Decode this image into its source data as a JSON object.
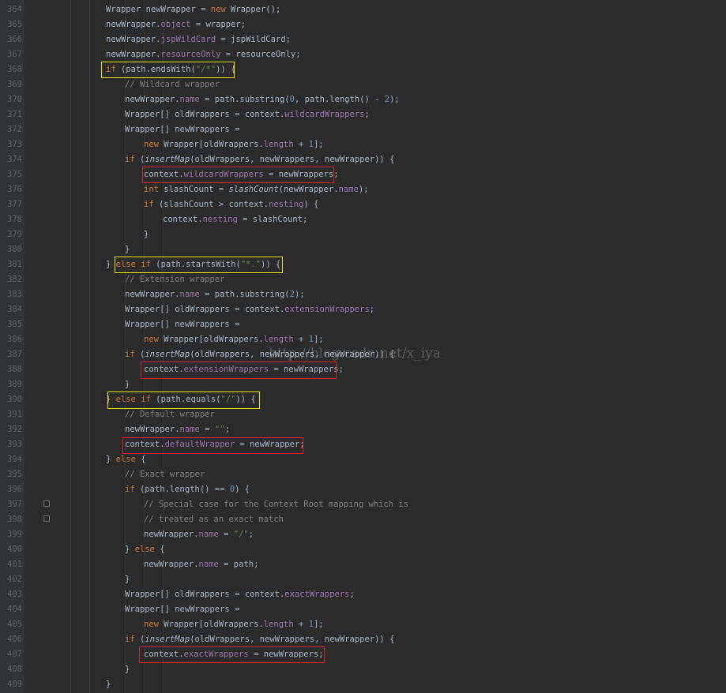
{
  "editor": {
    "watermark": "http://blog.csdn.net/x_iya",
    "lines": [
      {
        "n": "364",
        "i": 0,
        "t": [
          [
            "Wrapper newWrapper = ",
            ""
          ],
          [
            "new",
            "kw"
          ],
          [
            " Wrapper();",
            ""
          ]
        ]
      },
      {
        "n": "365",
        "i": 0,
        "t": [
          [
            "newWrapper.",
            ""
          ],
          [
            "object",
            "fd"
          ],
          [
            " = wrapper;",
            ""
          ]
        ]
      },
      {
        "n": "366",
        "i": 0,
        "t": [
          [
            "newWrapper.",
            ""
          ],
          [
            "jspWildCard",
            "fd"
          ],
          [
            " = jspWildCard;",
            ""
          ]
        ]
      },
      {
        "n": "367",
        "i": 0,
        "t": [
          [
            "newWrapper.",
            ""
          ],
          [
            "resourceOnly",
            "fd"
          ],
          [
            " = resourceOnly;",
            ""
          ]
        ]
      },
      {
        "n": "368",
        "i": 0,
        "t": [
          [
            "if",
            "kw"
          ],
          [
            " (path.endsWith(",
            ""
          ],
          [
            "\"/*\"",
            "str"
          ],
          [
            ")) {",
            ""
          ]
        ]
      },
      {
        "n": "369",
        "i": 1,
        "t": [
          [
            "// Wildcard wrapper",
            "cm"
          ]
        ]
      },
      {
        "n": "370",
        "i": 1,
        "t": [
          [
            "newWrapper.",
            ""
          ],
          [
            "name",
            "fd"
          ],
          [
            " = path.substring(",
            ""
          ],
          [
            "0",
            "num"
          ],
          [
            ", path.length() - ",
            ""
          ],
          [
            "2",
            "num"
          ],
          [
            ");",
            ""
          ]
        ]
      },
      {
        "n": "371",
        "i": 1,
        "t": [
          [
            "Wrapper[] oldWrappers = context.",
            ""
          ],
          [
            "wildcardWrappers",
            "fd"
          ],
          [
            ";",
            ""
          ]
        ]
      },
      {
        "n": "372",
        "i": 1,
        "t": [
          [
            "Wrapper[] newWrappers =",
            ""
          ]
        ]
      },
      {
        "n": "373",
        "i": 2,
        "t": [
          [
            "new",
            "kw"
          ],
          [
            " Wrapper[oldWrappers.",
            ""
          ],
          [
            "length",
            "fd"
          ],
          [
            " + ",
            ""
          ],
          [
            "1",
            "num"
          ],
          [
            "];",
            ""
          ]
        ]
      },
      {
        "n": "374",
        "i": 1,
        "t": [
          [
            "if",
            "kw"
          ],
          [
            " (",
            ""
          ],
          [
            "insertMap",
            "it"
          ],
          [
            "(oldWrappers, newWrappers, newWrapper)) {",
            ""
          ]
        ]
      },
      {
        "n": "375",
        "i": 2,
        "t": [
          [
            "context.",
            ""
          ],
          [
            "wildcardWrappers",
            "fd"
          ],
          [
            " = newWrappers;",
            ""
          ]
        ]
      },
      {
        "n": "376",
        "i": 2,
        "t": [
          [
            "int",
            "kw"
          ],
          [
            " slashCount = ",
            ""
          ],
          [
            "slashCount",
            "it"
          ],
          [
            "(newWrapper.",
            ""
          ],
          [
            "name",
            "fd"
          ],
          [
            ");",
            ""
          ]
        ]
      },
      {
        "n": "377",
        "i": 2,
        "t": [
          [
            "if",
            "kw"
          ],
          [
            " (slashCount > context.",
            ""
          ],
          [
            "nesting",
            "fd"
          ],
          [
            ") {",
            ""
          ]
        ]
      },
      {
        "n": "378",
        "i": 3,
        "t": [
          [
            "context.",
            ""
          ],
          [
            "nesting",
            "fd"
          ],
          [
            " = slashCount;",
            ""
          ]
        ]
      },
      {
        "n": "379",
        "i": 2,
        "t": [
          [
            "}",
            ""
          ]
        ]
      },
      {
        "n": "380",
        "i": 1,
        "t": [
          [
            "}",
            ""
          ]
        ]
      },
      {
        "n": "381",
        "i": 0,
        "t": [
          [
            "} ",
            ""
          ],
          [
            "else if",
            "kw"
          ],
          [
            " (path.startsWith(",
            ""
          ],
          [
            "\"*.\"",
            "str"
          ],
          [
            ")) {",
            ""
          ]
        ]
      },
      {
        "n": "382",
        "i": 1,
        "t": [
          [
            "// Extension wrapper",
            "cm"
          ]
        ]
      },
      {
        "n": "383",
        "i": 1,
        "t": [
          [
            "newWrapper.",
            ""
          ],
          [
            "name",
            "fd"
          ],
          [
            " = path.substring(",
            ""
          ],
          [
            "2",
            "num"
          ],
          [
            ");",
            ""
          ]
        ]
      },
      {
        "n": "384",
        "i": 1,
        "t": [
          [
            "Wrapper[] oldWrappers = context.",
            ""
          ],
          [
            "extensionWrappers",
            "fd"
          ],
          [
            ";",
            ""
          ]
        ]
      },
      {
        "n": "385",
        "i": 1,
        "t": [
          [
            "Wrapper[] newWrappers =",
            ""
          ]
        ]
      },
      {
        "n": "386",
        "i": 2,
        "t": [
          [
            "new",
            "kw"
          ],
          [
            " Wrapper[oldWrappers.",
            ""
          ],
          [
            "length",
            "fd"
          ],
          [
            " + ",
            ""
          ],
          [
            "1",
            "num"
          ],
          [
            "];",
            ""
          ]
        ]
      },
      {
        "n": "387",
        "i": 1,
        "t": [
          [
            "if",
            "kw"
          ],
          [
            " (",
            ""
          ],
          [
            "insertMap",
            "it"
          ],
          [
            "(oldWrappers, newWrappers, newWrapper)) {",
            ""
          ]
        ]
      },
      {
        "n": "388",
        "i": 2,
        "t": [
          [
            "context.",
            ""
          ],
          [
            "extensionWrappers",
            "fd"
          ],
          [
            " = newWrappers;",
            ""
          ]
        ]
      },
      {
        "n": "389",
        "i": 1,
        "t": [
          [
            "}",
            ""
          ]
        ]
      },
      {
        "n": "390",
        "i": 0,
        "t": [
          [
            "} ",
            ""
          ],
          [
            "else if",
            "kw"
          ],
          [
            " (path.equals(",
            ""
          ],
          [
            "\"/\"",
            "str"
          ],
          [
            ")) {",
            ""
          ]
        ]
      },
      {
        "n": "391",
        "i": 1,
        "t": [
          [
            "// Default wrapper",
            "cm"
          ]
        ]
      },
      {
        "n": "392",
        "i": 1,
        "t": [
          [
            "newWrapper.",
            ""
          ],
          [
            "name",
            "fd"
          ],
          [
            " = ",
            ""
          ],
          [
            "\"\"",
            "str"
          ],
          [
            ";",
            ""
          ]
        ]
      },
      {
        "n": "393",
        "i": 1,
        "t": [
          [
            "context.",
            ""
          ],
          [
            "defaultWrapper",
            "fd"
          ],
          [
            " = newWrapper;",
            ""
          ]
        ]
      },
      {
        "n": "394",
        "i": 0,
        "t": [
          [
            "} ",
            ""
          ],
          [
            "else",
            "kw"
          ],
          [
            " {",
            ""
          ]
        ]
      },
      {
        "n": "395",
        "i": 1,
        "t": [
          [
            "// Exact wrapper",
            "cm"
          ]
        ]
      },
      {
        "n": "396",
        "i": 1,
        "t": [
          [
            "if",
            "kw"
          ],
          [
            " (path.length() == ",
            ""
          ],
          [
            "0",
            "num"
          ],
          [
            ") {",
            ""
          ]
        ]
      },
      {
        "n": "397",
        "i": 2,
        "t": [
          [
            "// Special case for the Context Root mapping which is",
            "cm"
          ]
        ]
      },
      {
        "n": "398",
        "i": 2,
        "t": [
          [
            "// treated as an exact match",
            "cm"
          ]
        ]
      },
      {
        "n": "399",
        "i": 2,
        "t": [
          [
            "newWrapper.",
            ""
          ],
          [
            "name",
            "fd"
          ],
          [
            " = ",
            ""
          ],
          [
            "\"/\"",
            "str"
          ],
          [
            ";",
            ""
          ]
        ]
      },
      {
        "n": "400",
        "i": 1,
        "t": [
          [
            "} ",
            ""
          ],
          [
            "else",
            "kw"
          ],
          [
            " {",
            ""
          ]
        ]
      },
      {
        "n": "401",
        "i": 2,
        "t": [
          [
            "newWrapper.",
            ""
          ],
          [
            "name",
            "fd"
          ],
          [
            " = path;",
            ""
          ]
        ]
      },
      {
        "n": "402",
        "i": 1,
        "t": [
          [
            "}",
            ""
          ]
        ]
      },
      {
        "n": "403",
        "i": 1,
        "t": [
          [
            "Wrapper[] oldWrappers = context.",
            ""
          ],
          [
            "exactWrappers",
            "fd"
          ],
          [
            ";",
            ""
          ]
        ]
      },
      {
        "n": "404",
        "i": 1,
        "t": [
          [
            "Wrapper[] newWrappers =",
            ""
          ]
        ]
      },
      {
        "n": "405",
        "i": 2,
        "t": [
          [
            "new",
            "kw"
          ],
          [
            " Wrapper[oldWrappers.",
            ""
          ],
          [
            "length",
            "fd"
          ],
          [
            " + ",
            ""
          ],
          [
            "1",
            "num"
          ],
          [
            "];",
            ""
          ]
        ]
      },
      {
        "n": "406",
        "i": 1,
        "t": [
          [
            "if",
            "kw"
          ],
          [
            " (",
            ""
          ],
          [
            "insertMap",
            "it"
          ],
          [
            "(oldWrappers, newWrappers, newWrapper)) {",
            ""
          ]
        ]
      },
      {
        "n": "407",
        "i": 2,
        "t": [
          [
            "context.",
            ""
          ],
          [
            "exactWrappers",
            "fd"
          ],
          [
            " = newWrappers;",
            ""
          ]
        ]
      },
      {
        "n": "408",
        "i": 1,
        "t": [
          [
            "}",
            ""
          ]
        ]
      },
      {
        "n": "409",
        "i": 0,
        "t": [
          [
            "}",
            ""
          ]
        ]
      }
    ],
    "highlight_colors": {
      "yellow": "#e8e800",
      "red": "#e02020"
    },
    "syntax_colors": {
      "keyword": "#cc7832",
      "field": "#9876aa",
      "string": "#6a8759",
      "number": "#6897bb",
      "comment": "#808080",
      "text": "#a9b7c6"
    }
  }
}
